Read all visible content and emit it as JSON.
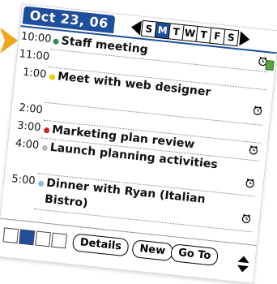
{
  "header": {
    "date": "Oct 23, 06",
    "days": [
      "S",
      "M",
      "T",
      "W",
      "T",
      "F",
      "S"
    ],
    "selected_day_index": 1
  },
  "agenda": [
    {
      "time": "10:00",
      "title": "Staff meeting",
      "dot_color": "#2e8b57",
      "alarm": true,
      "note": true
    },
    {
      "time": "11:00",
      "title": "",
      "dot_color": "",
      "alarm": false,
      "note": false
    },
    {
      "time": "1:00",
      "title": "Meet with web designer",
      "dot_color": "#f0d000",
      "alarm": true,
      "note": false
    },
    {
      "time": "2:00",
      "title": "",
      "dot_color": "",
      "alarm": false,
      "note": false
    },
    {
      "time": "3:00",
      "title": "Marketing plan review",
      "dot_color": "#cc2222",
      "alarm": true,
      "note": false
    },
    {
      "time": "4:00",
      "title": "Launch planning activities",
      "dot_color": "#b9b9b9",
      "alarm": true,
      "note": false
    },
    {
      "time": "5:00",
      "title": "Dinner with Ryan (Italian Bistro)",
      "dot_color": "#8fb9e6",
      "alarm": true,
      "note": false
    }
  ],
  "footer": {
    "buttons": {
      "details": "Details",
      "new": "New",
      "goto": "Go To"
    }
  },
  "colors": {
    "primary": "#1f4f9c",
    "accent_orange": "#f0a41b"
  },
  "icons": {
    "alarm": "alarm-clock-icon",
    "note": "note-icon",
    "prev": "previous-week-arrow-icon",
    "next": "next-week-arrow-icon",
    "scroll": "scroll-icon"
  }
}
